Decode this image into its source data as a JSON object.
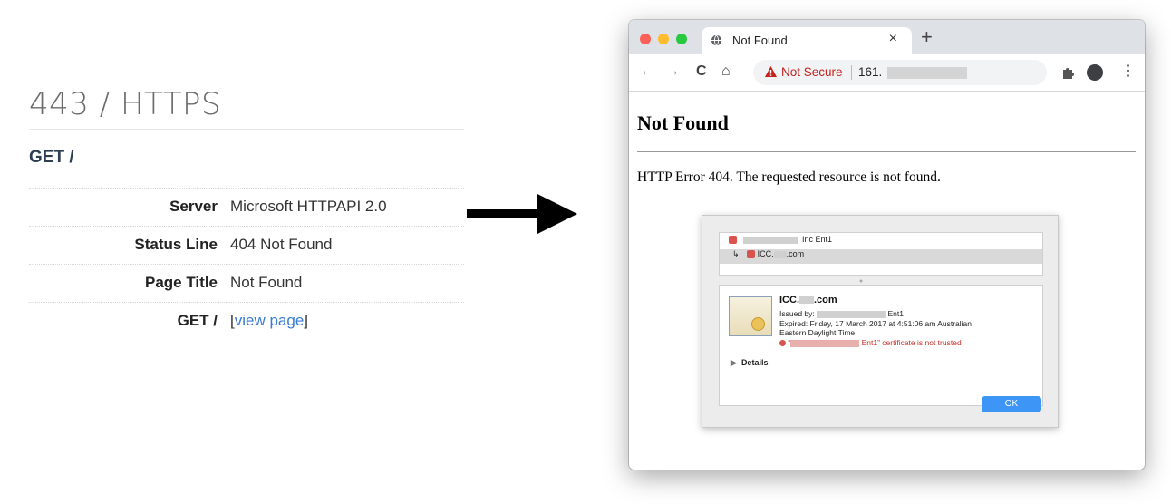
{
  "left_panel": {
    "port_title": "443 / HTTPS",
    "section": "GET /",
    "rows": [
      {
        "key": "Server",
        "value": "Microsoft HTTPAPI 2.0"
      },
      {
        "key": "Status Line",
        "value": "404 Not Found"
      },
      {
        "key": "Page Title",
        "value": "Not Found"
      },
      {
        "key": "GET /",
        "value_prefix": "[",
        "link": "view page",
        "value_suffix": "]"
      }
    ]
  },
  "browser": {
    "tab_title": "Not Found",
    "tab_close": "×",
    "new_tab": "+",
    "nav": {
      "back": "←",
      "forward": "→",
      "reload": "C",
      "home": "⌂"
    },
    "security_label": "Not Secure",
    "url_prefix": "161.",
    "star": "☆",
    "menu": "⋮",
    "page": {
      "heading": "Not Found",
      "message": "HTTP Error 404. The requested resource is not found."
    },
    "cert_dialog": {
      "list_items": [
        {
          "suffix": "Inc Ent1"
        },
        {
          "prefix": "ICC.",
          "suffix": ".com"
        }
      ],
      "common_name_prefix": "ICC.",
      "common_name_suffix": ".com",
      "issued_by_label": "Issued by:",
      "issued_by_suffix": "Ent1",
      "expired_line1": "Expired: Friday, 17 March 2017 at 4:51:06 am Australian",
      "expired_line2": "Eastern Daylight Time",
      "trust_error_prefix": "“",
      "trust_error_suffix": "Ent1” certificate is not trusted",
      "details_label": "Details",
      "ok_label": "OK"
    }
  },
  "colors": {
    "accent_link": "#3a7bd5",
    "not_secure": "#c5221f",
    "ok_button": "#3d95f5",
    "traffic_red": "#fe5f57",
    "traffic_yellow": "#febc2e",
    "traffic_green": "#28c840"
  }
}
